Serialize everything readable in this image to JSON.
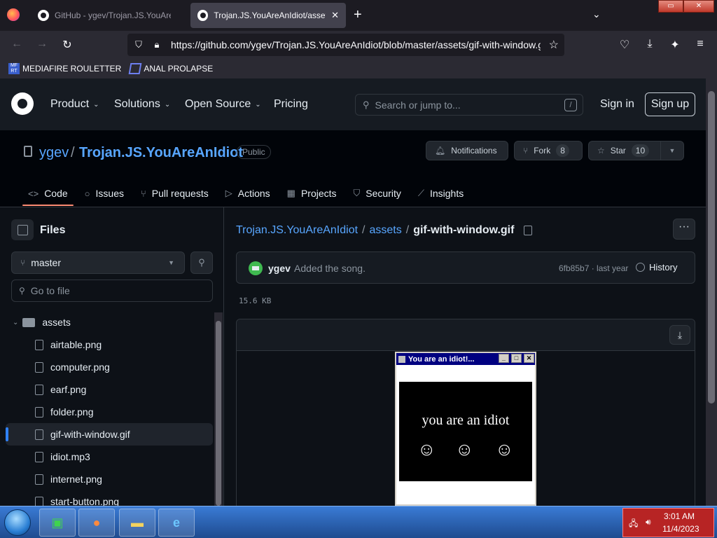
{
  "browser": {
    "tabs": [
      {
        "title": "GitHub - ygev/Trojan.JS.YouAreAnIdiot",
        "active": false
      },
      {
        "title": "Trojan.JS.YouAreAnIdiot/assets/gif-with-window.gif",
        "active": true
      }
    ],
    "new_tab": "+",
    "url": "https://github.com/ygev/Trojan.JS.YouAreAnIdiot/blob/master/assets/gif-with-window.gif",
    "bookmarks": [
      {
        "label": "MEDIAFIRE ROULETTER",
        "icon_text": "MF RT"
      },
      {
        "label": "ANAL PROLAPSE"
      }
    ]
  },
  "gh_header": {
    "nav": [
      "Product",
      "Solutions",
      "Open Source",
      "Pricing"
    ],
    "search_placeholder": "Search or jump to...",
    "search_key": "/",
    "sign_in": "Sign in",
    "sign_up": "Sign up"
  },
  "repo": {
    "owner": "ygev",
    "separator": "/",
    "name": "Trojan.JS.YouAreAnIdiot",
    "visibility": "Public",
    "notifications": "Notifications",
    "fork_label": "Fork",
    "fork_count": "8",
    "star_label": "Star",
    "star_count": "10",
    "tabs": [
      {
        "label": "Code",
        "icon": "<>",
        "active": true
      },
      {
        "label": "Issues",
        "icon": "○"
      },
      {
        "label": "Pull requests",
        "icon": "⑂"
      },
      {
        "label": "Actions",
        "icon": "▷"
      },
      {
        "label": "Projects",
        "icon": "▦"
      },
      {
        "label": "Security",
        "icon": "⛉"
      },
      {
        "label": "Insights",
        "icon": "⟋"
      }
    ]
  },
  "sidebar": {
    "title": "Files",
    "branch": "master",
    "goto_placeholder": "Go to file",
    "folder": "assets",
    "files": [
      "airtable.png",
      "computer.png",
      "earf.png",
      "folder.png",
      "gif-with-window.gif",
      "idiot.mp3",
      "internet.png",
      "start-button.png"
    ],
    "selected": "gif-with-window.gif"
  },
  "main": {
    "crumb_repo": "Trojan.JS.YouAreAnIdiot",
    "crumb_folder": "assets",
    "crumb_file": "gif-with-window.gif",
    "crumb_sep": "/",
    "more": "···",
    "commit_author": "ygev",
    "commit_message": "Added the song.",
    "commit_sha_time": "6fb85b7 · last year",
    "history": "History",
    "file_size": "15.6 KB",
    "download_icon": "download-icon"
  },
  "gif": {
    "window_title": "You are an idiot!...",
    "text": "you are an idiot",
    "smiley": "☺"
  },
  "taskbar": {
    "time": "3:01 AM",
    "date": "11/4/2023"
  },
  "colors": {
    "accent": "#58a6ff",
    "tab_underline": "#fd8c73",
    "selected_bar": "#2f81f7",
    "tray": "#b72424"
  }
}
